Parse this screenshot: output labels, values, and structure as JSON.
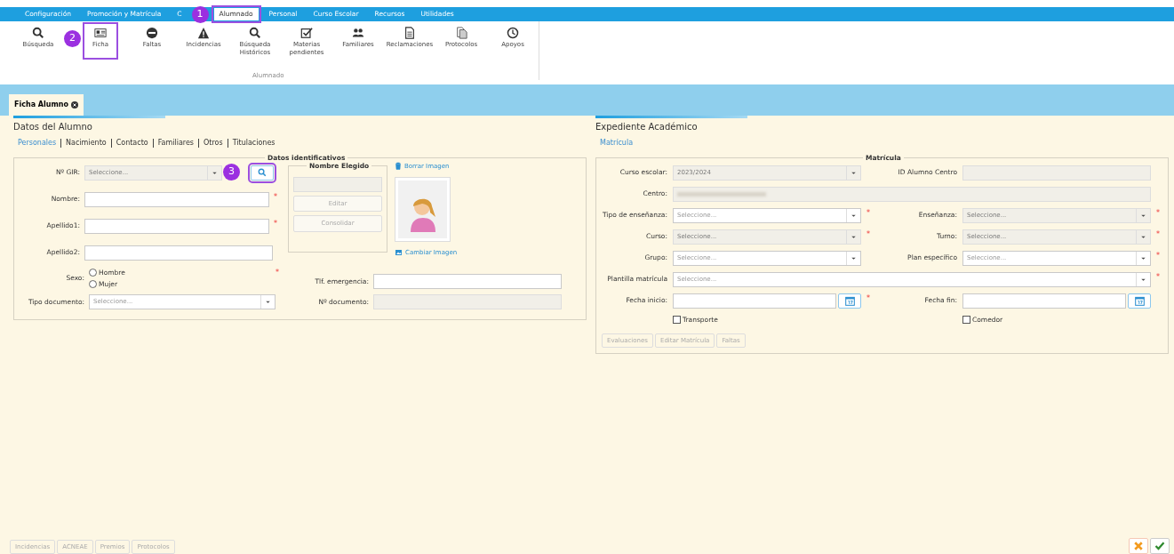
{
  "top_menu": [
    {
      "label": "Configuración",
      "selected": false
    },
    {
      "label": "Promoción y Matrícula",
      "selected": false
    },
    {
      "label": "C",
      "selected": false
    },
    {
      "label": "Alumnado",
      "selected": true,
      "annotation": "1"
    },
    {
      "label": "Personal",
      "selected": false
    },
    {
      "label": "Curso Escolar",
      "selected": false
    },
    {
      "label": "Recursos",
      "selected": false
    },
    {
      "label": "Utilidades",
      "selected": false
    }
  ],
  "ribbon": {
    "items": [
      {
        "label": "Búsqueda"
      },
      {
        "label": "Ficha",
        "annotation": "2"
      },
      {
        "label": "Faltas"
      },
      {
        "label": "Incidencias"
      },
      {
        "label": "Búsqueda Históricos"
      },
      {
        "label": "Materias pendientes"
      },
      {
        "label": "Familiares"
      },
      {
        "label": "Reclamaciones"
      },
      {
        "label": "Protocolos"
      },
      {
        "label": "Apoyos"
      }
    ],
    "group_label": "Alumnado"
  },
  "tabs": [
    {
      "label": "Ficha Alumno",
      "selected": true
    }
  ],
  "student": {
    "title": "Datos del Alumno",
    "subtabs": [
      {
        "label": "Personales",
        "selected": true
      },
      {
        "label": "Nacimiento",
        "selected": false
      },
      {
        "label": "Contacto",
        "selected": false
      },
      {
        "label": "Familiares",
        "selected": false
      },
      {
        "label": "Otros",
        "selected": false
      },
      {
        "label": "Titulaciones",
        "selected": false
      }
    ],
    "legend": "Datos identificativos",
    "gir": {
      "label": "Nº GIR:",
      "placeholder": "Seleccione...",
      "search_annotation": "3"
    },
    "fields": [
      {
        "label": "Nombre:",
        "required_mark": "*"
      },
      {
        "label": "Apellido1:",
        "required_mark": "*"
      },
      {
        "label": "Apellido2:"
      }
    ],
    "chosen_name": {
      "legend": "Nombre Elegido",
      "buttons": [
        "Editar",
        "Consolidar"
      ]
    },
    "photo": {
      "delete": "Borrar Imagen",
      "change": "Cambiar Imagen"
    },
    "sexo": {
      "label": "Sexo:",
      "required_mark": "*",
      "options": [
        {
          "label": "Hombre",
          "selected": false
        },
        {
          "label": "Mujer",
          "selected": false
        }
      ]
    },
    "tlf": {
      "label": "Tlf. emergencia:",
      "disabled": false
    },
    "tipo_doc": {
      "label": "Tipo documento:",
      "placeholder": "Seleccione..."
    },
    "num_doc": {
      "label": "Nº documento:",
      "disabled": true
    }
  },
  "record": {
    "title": "Expediente Académico",
    "subtabs": [
      {
        "label": "Matrícula",
        "selected": true
      }
    ],
    "legend": "Matrícula",
    "rows": [
      [
        {
          "label": "Curso escolar:",
          "kind": "select",
          "value": "2023/2024",
          "disabled": true
        },
        {
          "label": "ID Alumno Centro",
          "kind": "text",
          "disabled": true
        }
      ],
      [
        {
          "label": "Centro:",
          "kind": "wide-blurred",
          "disabled": true
        }
      ],
      [
        {
          "label": "Tipo de enseñanza:",
          "kind": "select",
          "placeholder": "Seleccione...",
          "disabled": false,
          "required_mark": "*"
        },
        {
          "label": "Enseñanza:",
          "kind": "select",
          "placeholder": "Seleccione...",
          "disabled": true,
          "required_mark": "*"
        }
      ],
      [
        {
          "label": "Curso:",
          "kind": "select",
          "placeholder": "Seleccione...",
          "disabled": true,
          "required_mark": "*"
        },
        {
          "label": "Turno:",
          "kind": "select",
          "placeholder": "Seleccione...",
          "disabled": true,
          "required_mark": "*"
        }
      ],
      [
        {
          "label": "Grupo:",
          "kind": "select",
          "placeholder": "Seleccione...",
          "disabled": false
        },
        {
          "label": "Plan específico",
          "kind": "select",
          "placeholder": "Seleccione...",
          "disabled": false,
          "required_mark": "*"
        }
      ],
      [
        {
          "label": "Plantilla matrícula",
          "kind": "wide-select",
          "placeholder": "Seleccione...",
          "disabled": false,
          "required_mark": "*"
        }
      ],
      [
        {
          "label": "Fecha inicio:",
          "kind": "date",
          "disabled": false,
          "required_mark": "*"
        },
        {
          "label": "Fecha fin:",
          "kind": "date",
          "disabled": false
        }
      ]
    ],
    "checks": [
      {
        "label": "Transporte",
        "checked": false
      },
      {
        "label": "Comedor",
        "checked": false
      }
    ],
    "buttons": [
      "Evaluaciones",
      "Editar Matrícula",
      "Faltas"
    ]
  },
  "footer_buttons": [
    "Incidencias",
    "ACNEAE",
    "Premios",
    "Protocolos"
  ]
}
